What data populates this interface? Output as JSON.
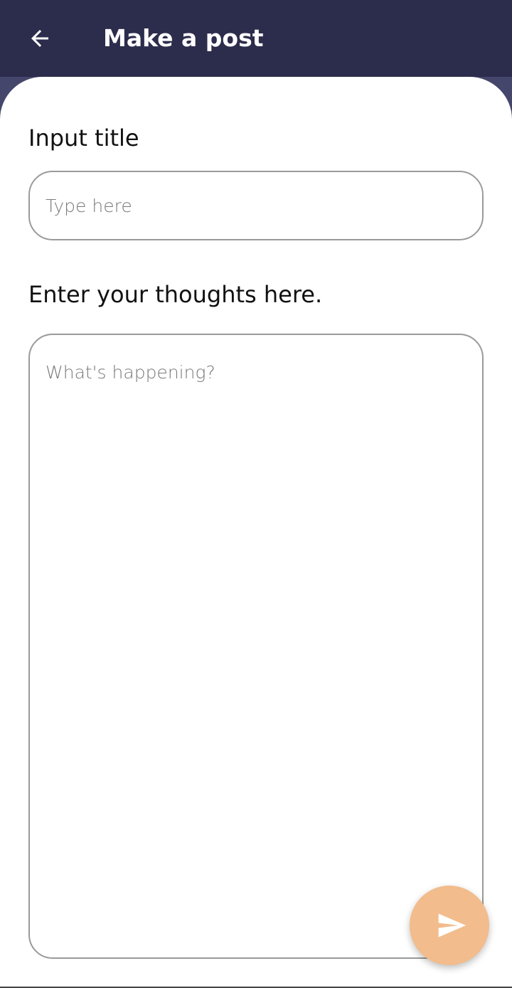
{
  "app_bar": {
    "title": "Make a post",
    "back_icon": "arrow-left-icon"
  },
  "form": {
    "title_label": "Input title",
    "title_placeholder": "Type here",
    "body_label": "Enter your thoughts here.",
    "body_placeholder": "What's happening?"
  },
  "fab": {
    "icon": "send-icon",
    "color": "#f2bc8c"
  },
  "colors": {
    "app_bar": "#2c2c4c",
    "surface": "#ffffff"
  }
}
